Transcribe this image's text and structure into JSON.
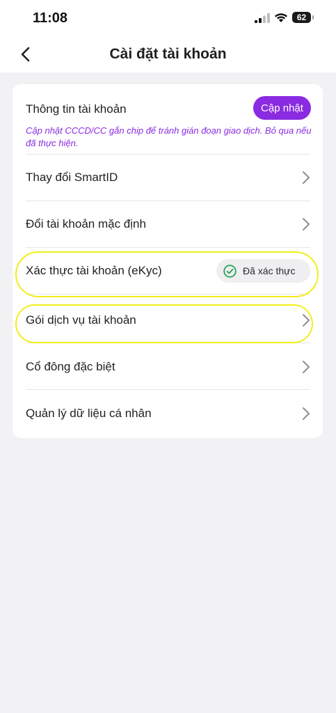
{
  "status_bar": {
    "time": "11:08",
    "battery": "62"
  },
  "header": {
    "title": "Cài đặt tài khoản"
  },
  "account_info": {
    "title": "Thông tin tài khoản",
    "update_button": "Cập nhật",
    "note": "Cập nhật CCCD/CC gắn chip để tránh gián đoạn giao dịch. Bỏ qua nếu đã thực hiện."
  },
  "menu": {
    "items": [
      {
        "label": "Thay đổi SmartID"
      },
      {
        "label": "Đổi tài khoản mặc định"
      },
      {
        "label": "Xác thực tài khoản (eKyc)",
        "badge": "Đã xác thực"
      },
      {
        "label": "Gói dịch vụ tài khoản"
      },
      {
        "label": "Cổ đông đặc biệt"
      },
      {
        "label": "Quản lý dữ liệu cá nhân"
      }
    ]
  },
  "colors": {
    "accent": "#8a2be2",
    "verified_green": "#27a35a",
    "highlight": "#f2ee1a",
    "background": "#f2f2f5"
  }
}
